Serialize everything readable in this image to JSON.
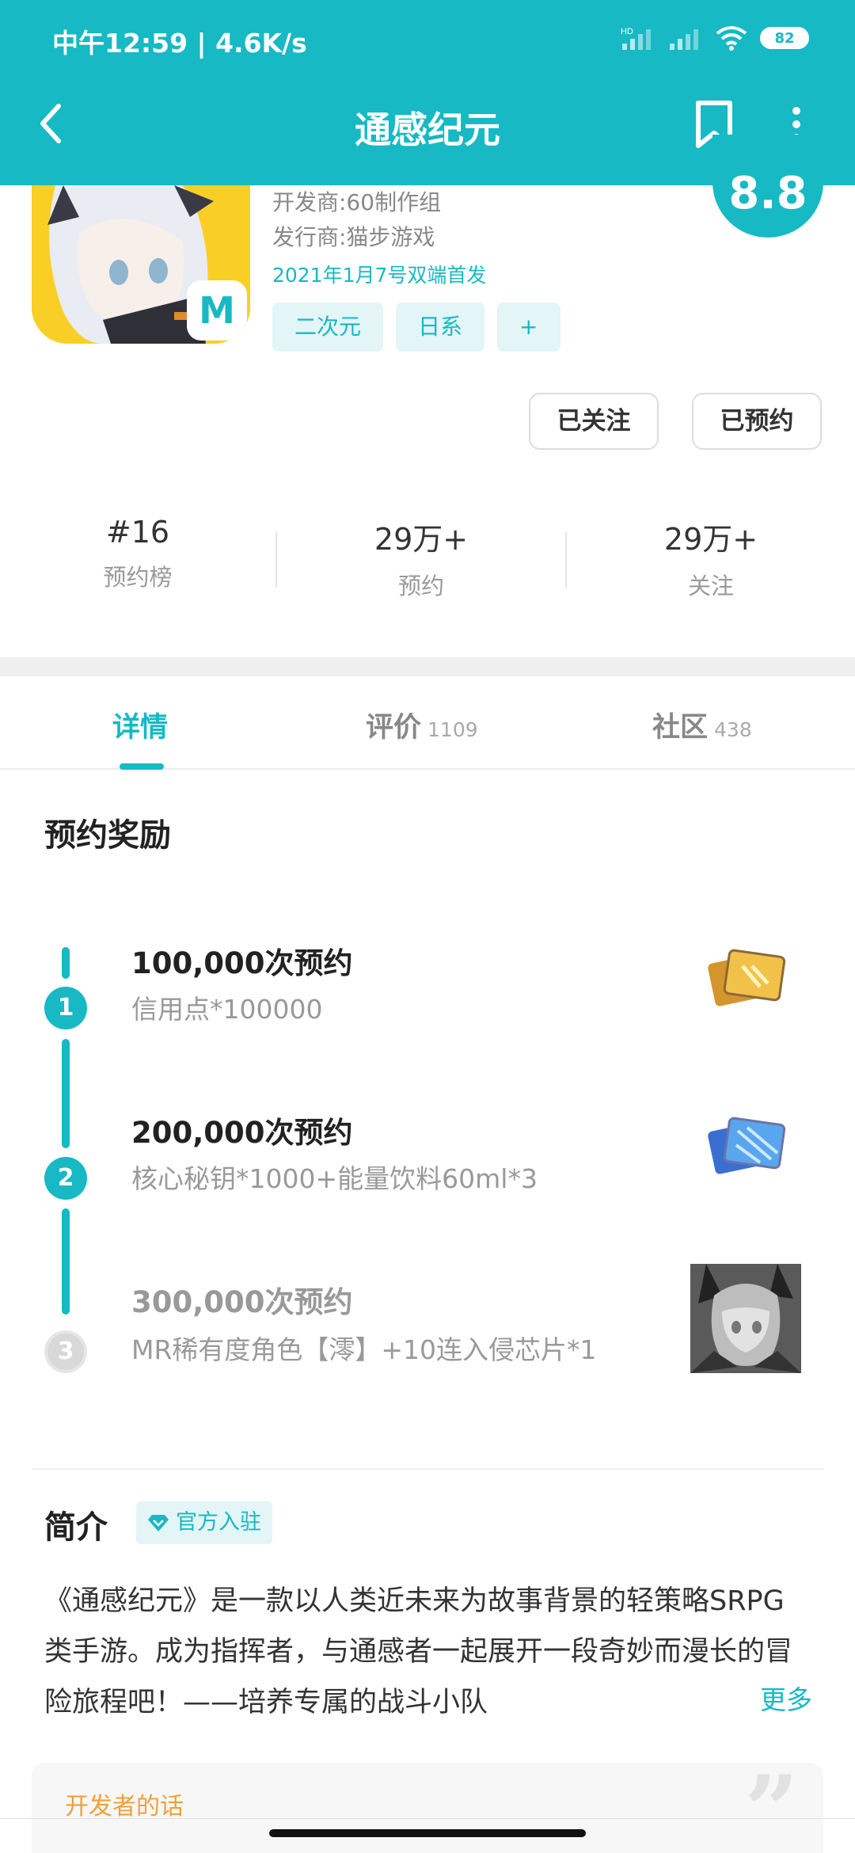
{
  "status_bar": {
    "time": "中午12:59 | 4.6K/s",
    "network_label": "HD",
    "battery": "82"
  },
  "header": {
    "title": "通感纪元",
    "icons": {
      "back": "back-arrow-icon",
      "bookmark": "bookmark-icon",
      "more": "more-vertical-icon"
    }
  },
  "app": {
    "developer": "开发商:60制作组",
    "publisher": "发行商:猫步游戏",
    "release": "2021年1月7号双端首发",
    "score": "8.8",
    "icon_badge": "M",
    "tags": [
      "二次元",
      "日系",
      "+"
    ]
  },
  "actions": {
    "follow": "已关注",
    "reserved": "已预约"
  },
  "stats": [
    {
      "value": "#16",
      "label": "预约榜"
    },
    {
      "value": "29万+",
      "label": "预约"
    },
    {
      "value": "29万+",
      "label": "关注"
    }
  ],
  "tabs": [
    {
      "label": "详情",
      "count": ""
    },
    {
      "label": "评价",
      "count": "1109"
    },
    {
      "label": "社区",
      "count": "438"
    }
  ],
  "rewards": {
    "title": "预约奖励",
    "milestones": [
      {
        "step": "1",
        "title": "100,000次预约",
        "desc": "信用点*100000",
        "achieved": true
      },
      {
        "step": "2",
        "title": "200,000次预约",
        "desc": "核心秘钥*1000+能量饮料60ml*3",
        "achieved": true
      },
      {
        "step": "3",
        "title": "300,000次预约",
        "desc": "MR稀有度角色【澪】+10连入侵芯片*1",
        "achieved": false
      }
    ]
  },
  "intro": {
    "title": "简介",
    "official_badge": "官方入驻",
    "text": "《通感纪元》是一款以人类近未来为故事背景的轻策略SRPG类手游。成为指挥者，与通感者一起展开一段奇妙而漫长的冒险旅程吧！——培养专属的战斗小队",
    "more": "更多"
  },
  "dev_words": {
    "title": "开发者的话"
  },
  "colors": {
    "primary": "#16b9c4",
    "tag_bg": "#e3f5f6",
    "dev_words_title": "#f0a03a"
  }
}
